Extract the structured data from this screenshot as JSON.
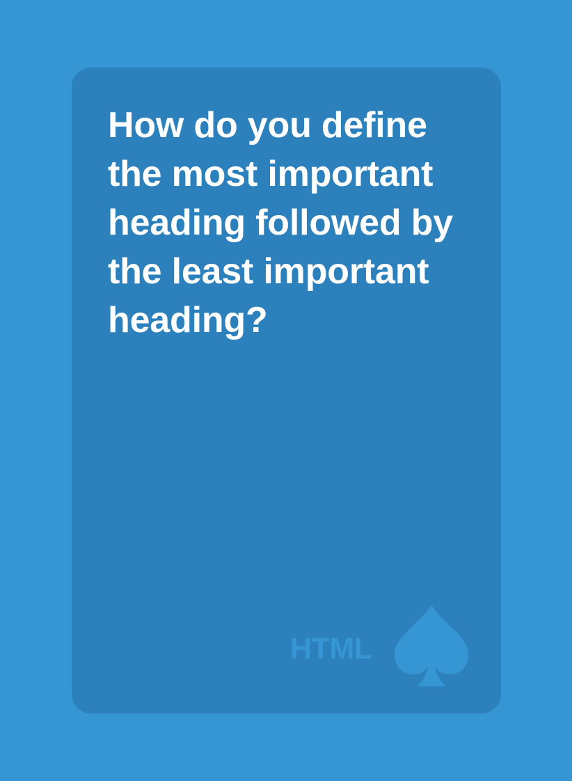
{
  "card": {
    "question": "How do you define the most important heading followed by the least important heading?",
    "category": "HTML",
    "suit_icon": "spade-icon"
  },
  "colors": {
    "background": "#3596d3",
    "card": "#2c81bd",
    "text": "#ffffff",
    "accent": "#3596d3"
  }
}
